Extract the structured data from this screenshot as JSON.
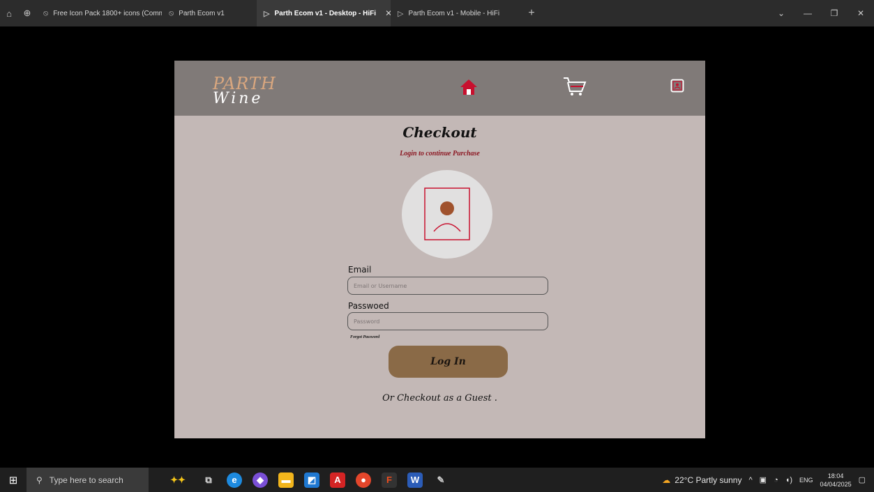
{
  "browser": {
    "tabs": [
      {
        "label": "Free Icon Pack 1800+ icons (Commur",
        "icon": "figma-community-icon"
      },
      {
        "label": "Parth Ecom v1",
        "icon": "figma-community-icon"
      },
      {
        "label": "Parth Ecom v1 - Desktop - HiFi",
        "icon": "play-icon",
        "active": true
      },
      {
        "label": "Parth Ecom v1 - Mobile - HiFi",
        "icon": "play-icon"
      }
    ]
  },
  "site": {
    "logo_line1": "PARTH",
    "logo_line2": "Wine",
    "nav": {
      "home": "home-icon",
      "cart": "cart-icon",
      "account": "account-icon"
    },
    "colors": {
      "header": "#807a78",
      "body": "#c3b8b6",
      "accent": "#c8102e",
      "button": "#8a6a47"
    }
  },
  "checkout": {
    "title": "Checkout",
    "subtitle": "Login to continue Purchase",
    "email_label": "Email",
    "email_placeholder": "Email or Username",
    "password_label": "Passwoed",
    "password_placeholder": "Password",
    "forgot": "Forgot Password",
    "login_button": "Log In",
    "guest": "Or Checkout as a Guest ."
  },
  "taskbar": {
    "search_placeholder": "Type here to search",
    "weather": "22°C  Partly sunny",
    "lang": "ENG",
    "time": "18:04",
    "date": "04/04/2025"
  }
}
